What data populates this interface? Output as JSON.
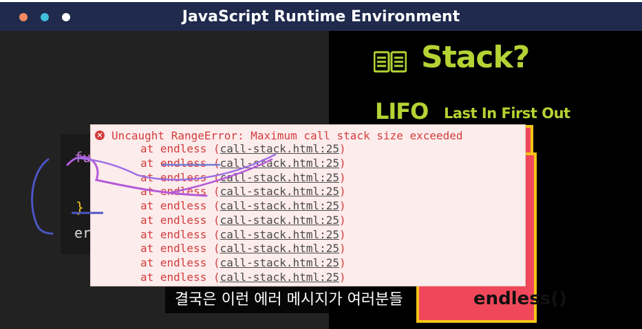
{
  "window": {
    "title": "JavaScript Runtime Environment",
    "traffic_lights": [
      "#f28b5e",
      "#3fc1d9",
      "#ffffff"
    ]
  },
  "code": {
    "line1": "fu",
    "line2": "}",
    "line3": "er"
  },
  "slide": {
    "icon": "book-icon",
    "heading": "Stack?",
    "lifo": "LIFO",
    "lifo_expansion": "Last In First Out",
    "stack_frame_label": "endless()",
    "accent_color": "#b5d334",
    "stack_color": "#f0485a",
    "stack_border_color": "#f5c518"
  },
  "console_error": {
    "icon": "error-circle-icon",
    "message": "Uncaught RangeError: Maximum call stack size exceeded",
    "frames": [
      {
        "prefix": "at endless (",
        "link": "call-stack.html:25",
        "suffix": ")"
      },
      {
        "prefix": "at endless (",
        "link": "call-stack.html:25",
        "suffix": ")"
      },
      {
        "prefix": "at endless (",
        "link": "call-stack.html:25",
        "suffix": ")"
      },
      {
        "prefix": "at endless (",
        "link": "call-stack.html:25",
        "suffix": ")"
      },
      {
        "prefix": "at endless (",
        "link": "call-stack.html:25",
        "suffix": ")"
      },
      {
        "prefix": "at endless (",
        "link": "call-stack.html:25",
        "suffix": ")"
      },
      {
        "prefix": "at endless (",
        "link": "call-stack.html:25",
        "suffix": ")"
      },
      {
        "prefix": "at endless (",
        "link": "call-stack.html:25",
        "suffix": ")"
      },
      {
        "prefix": "at endless (",
        "link": "call-stack.html:25",
        "suffix": ")"
      },
      {
        "prefix": "at endless (",
        "link": "call-stack.html:25",
        "suffix": ")"
      }
    ],
    "error_color": "#d33c3c"
  },
  "subtitle": "결국은 이런 에러 메시지가 여러분들"
}
